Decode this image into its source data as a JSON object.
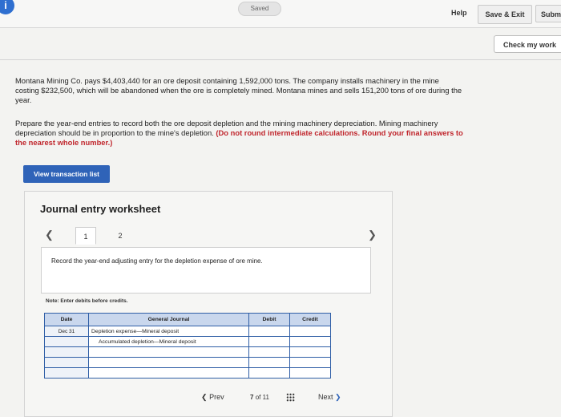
{
  "header": {
    "saved_label": "Saved",
    "help_label": "Help",
    "save_exit_label": "Save & Exit",
    "submit_label": "Subm",
    "check_label": "Check my work"
  },
  "problem": {
    "line1": "Montana Mining Co. pays $4,403,440 for an ore deposit containing 1,592,000 tons. The company installs machinery in the mine",
    "line2": "costing $232,500, which will be abandoned when the ore is completely mined. Montana mines and sells 151,200 tons of ore during the",
    "line3": "year.",
    "prep1": "Prepare the year-end entries to record both the ore deposit depletion and the mining machinery depreciation. Mining machinery",
    "prep2_plain": "depreciation should be in proportion to the mine's depletion. ",
    "prep2_bold": "(Do not round intermediate calculations. Round your final answers to",
    "prep3_bold": "the nearest whole number.)"
  },
  "view_transaction_label": "View transaction list",
  "worksheet": {
    "title": "Journal entry worksheet",
    "tabs": [
      "1",
      "2"
    ],
    "instruction": "Record the year-end adjusting entry for the depletion expense of ore mine.",
    "note": "Note: Enter debits before credits.",
    "columns": {
      "date": "Date",
      "general_journal": "General Journal",
      "debit": "Debit",
      "credit": "Credit"
    },
    "rows": [
      {
        "date": "Dec 31",
        "account": "Depletion expense—Mineral deposit",
        "debit": "",
        "credit": ""
      },
      {
        "date": "",
        "account": "Accumulated depletion—Mineral deposit",
        "debit": "",
        "credit": ""
      },
      {
        "date": "",
        "account": "",
        "debit": "",
        "credit": ""
      },
      {
        "date": "",
        "account": "",
        "debit": "",
        "credit": ""
      },
      {
        "date": "",
        "account": "",
        "debit": "",
        "credit": ""
      }
    ]
  },
  "pagination": {
    "prev_label": "Prev",
    "page_current": "7",
    "page_of": "of",
    "page_total": "11",
    "next_label": "Next"
  },
  "icons": {
    "info": "info-icon",
    "prev": "chevron-left-icon",
    "next": "chevron-right-icon",
    "grid": "grid-icon"
  },
  "colors": {
    "accent_button": "#2f63b8",
    "table_border": "#2f5ea6",
    "table_header": "#c9d7ed",
    "warning_text": "#c0262d"
  }
}
